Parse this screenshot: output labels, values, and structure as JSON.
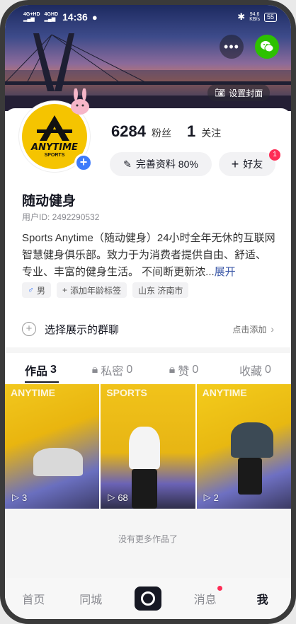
{
  "status_bar": {
    "network_1": "4G+HD",
    "network_2": "4GHD",
    "time": "14:36",
    "speed_value": "94.6",
    "speed_unit": "KB/s",
    "battery": "55"
  },
  "cover": {
    "set_cover_label": "设置封面"
  },
  "avatar": {
    "logo_text": "ANYTIME",
    "logo_sub": "SPORTS"
  },
  "stats": {
    "fans_count": "6284",
    "fans_label": "粉丝",
    "following_count": "1",
    "following_label": "关注"
  },
  "actions": {
    "complete_profile_label": "完善资料 80%",
    "friends_label": "好友",
    "friends_badge": "1"
  },
  "profile": {
    "name": "随动健身",
    "user_id": "用户ID: 2492290532",
    "bio": "Sports Anytime（随动健身）24小时全年无休的互联网智慧健身俱乐部。致力于为消费者提供自由、舒适、专业、丰富的健身生活。 不间断更新浓...",
    "bio_expand": "展开",
    "tags": {
      "gender": "男",
      "add_age": "添加年龄标签",
      "location": "山东 济南市"
    }
  },
  "group_chat": {
    "title": "选择展示的群聊",
    "action": "点击添加"
  },
  "tabs": {
    "works": "作品",
    "works_count": "3",
    "private": "私密",
    "private_count": "0",
    "likes": "赞",
    "likes_count": "0",
    "favorites": "收藏",
    "favorites_count": "0"
  },
  "videos": [
    {
      "plays": "3",
      "overlay": "ANYTIME"
    },
    {
      "plays": "68",
      "overlay": "SPORTS"
    },
    {
      "plays": "2",
      "overlay": "ANYTIME"
    }
  ],
  "no_more_text": "没有更多作品了",
  "bottom_nav": {
    "home": "首页",
    "local": "同城",
    "messages": "消息",
    "me": "我"
  },
  "colors": {
    "accent_red": "#fe2c55",
    "badge_blue": "#3e7bfa",
    "wechat_green": "#2dc100",
    "brand_yellow": "#f5c400"
  }
}
